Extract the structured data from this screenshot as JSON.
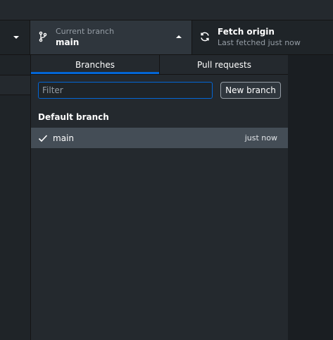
{
  "toolbar": {
    "current_branch": {
      "label": "Current branch",
      "value": "main",
      "icon": "git-branch-icon"
    },
    "fetch": {
      "label": "Fetch origin",
      "status": "Last fetched just now",
      "icon": "sync-icon"
    }
  },
  "dropdown": {
    "tabs": [
      {
        "label": "Branches",
        "selected": true
      },
      {
        "label": "Pull requests",
        "selected": false
      }
    ],
    "filter": {
      "placeholder": "Filter",
      "value": ""
    },
    "new_branch_label": "New branch",
    "default_section": {
      "title": "Default branch",
      "branches": [
        {
          "name": "main",
          "time": "just now",
          "checked": true
        }
      ]
    }
  },
  "colors": {
    "accent": "#0366d6",
    "background": "#24292e",
    "selected_row": "#444d56",
    "muted_text": "#959da5"
  }
}
